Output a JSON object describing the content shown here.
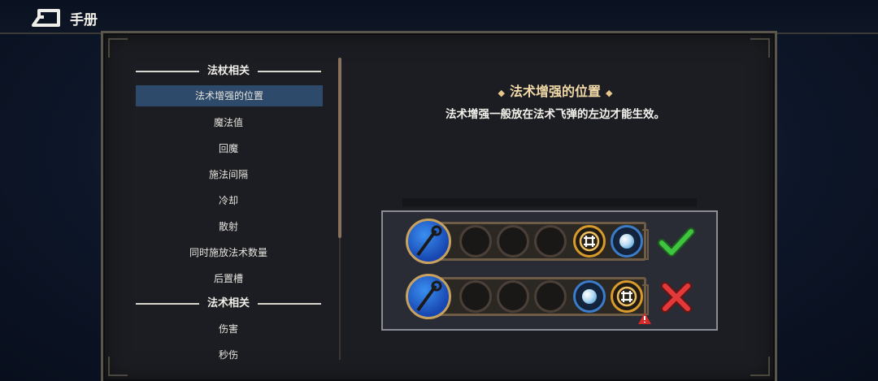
{
  "header": {
    "title": "手册",
    "back_icon": "back-arrow-icon"
  },
  "sidebar": {
    "sections": [
      {
        "title": "法杖相关",
        "items": [
          "法术增强的位置",
          "魔法值",
          "回魔",
          "施法间隔",
          "冷却",
          "散射",
          "同时施放法术数量",
          "后置槽"
        ]
      },
      {
        "title": "法术相关",
        "items": [
          "伤害",
          "秒伤"
        ]
      }
    ],
    "active_item": "法术增强的位置"
  },
  "content": {
    "title": "法术增强的位置",
    "description": "法术增强一般放在法术飞弹的左边才能生效。"
  },
  "example": {
    "rows": [
      {
        "result": "correct",
        "order": [
          "wand",
          "empty",
          "empty",
          "empty",
          "enhance",
          "missile"
        ]
      },
      {
        "result": "wrong",
        "order": [
          "wand",
          "empty",
          "empty",
          "empty",
          "missile",
          "enhance"
        ]
      }
    ],
    "colors": {
      "correct": "#3ec43e",
      "wrong": "#e23a3a",
      "accent": "#f2d9a8",
      "active_nav": "#2e4a6a"
    }
  }
}
